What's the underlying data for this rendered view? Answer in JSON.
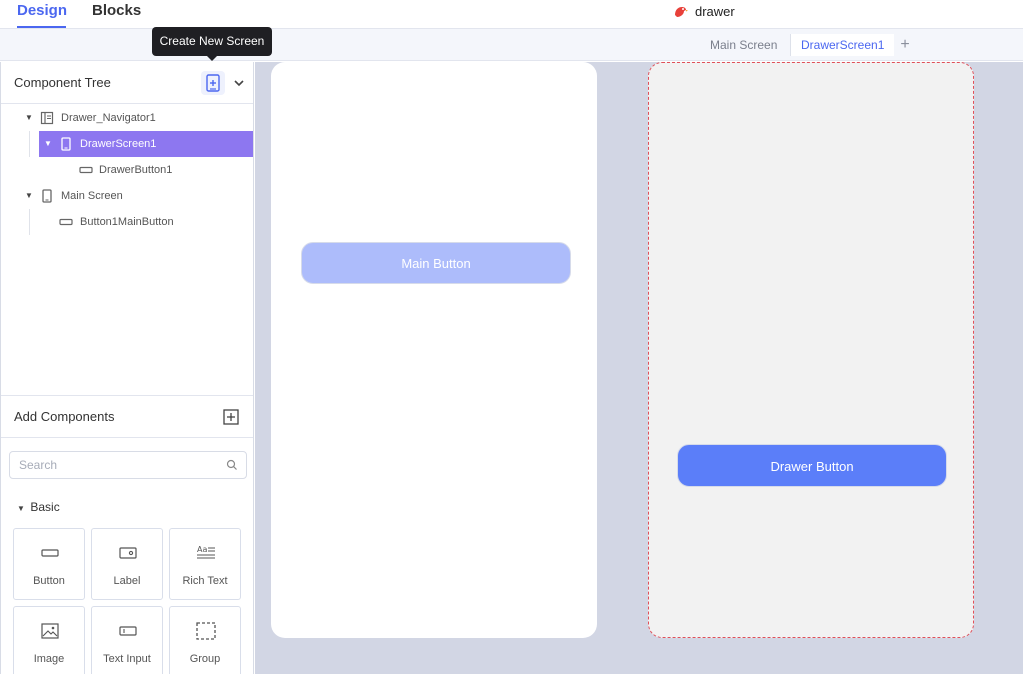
{
  "top_tabs": {
    "design": "Design",
    "blocks": "Blocks"
  },
  "project": {
    "name": "drawer",
    "logo_icon": "bird-logo-icon"
  },
  "screen_tabs": [
    {
      "label": "Main Screen"
    },
    {
      "label": "DrawerScreen1",
      "active": true
    }
  ],
  "tooltip": "Create New Screen",
  "component_tree": {
    "title": "Component Tree",
    "items": [
      {
        "label": "Drawer_Navigator1",
        "icon": "navigator-icon",
        "expanded": true
      },
      {
        "label": "DrawerScreen1",
        "icon": "phone-icon",
        "expanded": true,
        "selected": true
      },
      {
        "label": "DrawerButton1",
        "icon": "button-icon"
      },
      {
        "label": "Main Screen",
        "icon": "phone-icon",
        "expanded": true
      },
      {
        "label": "Button1MainButton",
        "icon": "button-icon"
      }
    ]
  },
  "add_components": {
    "title": "Add Components",
    "search_placeholder": "Search",
    "category": "Basic",
    "items": [
      {
        "label": "Button",
        "icon": "button-icon"
      },
      {
        "label": "Label",
        "icon": "label-icon"
      },
      {
        "label": "Rich Text",
        "icon": "rich-text-icon"
      },
      {
        "label": "Image",
        "icon": "image-icon"
      },
      {
        "label": "Text Input",
        "icon": "text-input-icon"
      },
      {
        "label": "Group",
        "icon": "group-icon"
      }
    ]
  },
  "canvas": {
    "main_screen_button": "Main Button",
    "drawer_screen_button": "Drawer Button"
  },
  "colors": {
    "accent": "#4b67f0",
    "selected_row": "#8d77f0",
    "main_button": "#adbcfb",
    "drawer_button": "#5b7ef9",
    "canvas_bg": "#d2d6e4"
  }
}
